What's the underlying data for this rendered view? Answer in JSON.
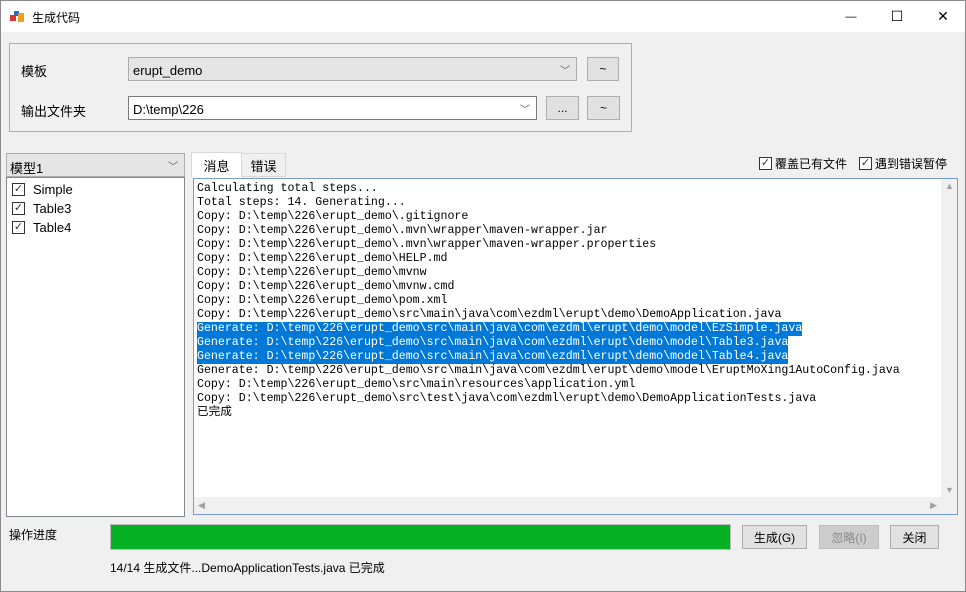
{
  "window": {
    "title": "生成代码",
    "minimize": "—",
    "maximize": "☐",
    "close": "✕"
  },
  "template": {
    "label": "模板",
    "value": "erupt_demo",
    "tilde": "~"
  },
  "output": {
    "label": "输出文件夹",
    "value": "D:\\temp\\226",
    "browse": "...",
    "tilde": "~"
  },
  "model": {
    "selected": "模型1",
    "items": [
      {
        "label": "Simple",
        "checked": true
      },
      {
        "label": "Table3",
        "checked": true
      },
      {
        "label": "Table4",
        "checked": true
      }
    ]
  },
  "tabs": [
    {
      "label": "消息",
      "active": true
    },
    {
      "label": "错误",
      "active": false
    }
  ],
  "options": {
    "overwrite": "覆盖已有文件",
    "pause_on_error": "遇到错误暂停"
  },
  "log": [
    {
      "text": "Calculating total steps...",
      "sel": false
    },
    {
      "text": "Total steps: 14. Generating...",
      "sel": false
    },
    {
      "text": "Copy: D:\\temp\\226\\erupt_demo\\.gitignore",
      "sel": false
    },
    {
      "text": "Copy: D:\\temp\\226\\erupt_demo\\.mvn\\wrapper\\maven-wrapper.jar",
      "sel": false
    },
    {
      "text": "Copy: D:\\temp\\226\\erupt_demo\\.mvn\\wrapper\\maven-wrapper.properties",
      "sel": false
    },
    {
      "text": "Copy: D:\\temp\\226\\erupt_demo\\HELP.md",
      "sel": false
    },
    {
      "text": "Copy: D:\\temp\\226\\erupt_demo\\mvnw",
      "sel": false
    },
    {
      "text": "Copy: D:\\temp\\226\\erupt_demo\\mvnw.cmd",
      "sel": false
    },
    {
      "text": "Copy: D:\\temp\\226\\erupt_demo\\pom.xml",
      "sel": false
    },
    {
      "text": "Copy: D:\\temp\\226\\erupt_demo\\src\\main\\java\\com\\ezdml\\erupt\\demo\\DemoApplication.java",
      "sel": false
    },
    {
      "text": "Generate: D:\\temp\\226\\erupt_demo\\src\\main\\java\\com\\ezdml\\erupt\\demo\\model\\EzSimple.java",
      "sel": true
    },
    {
      "text": "Generate: D:\\temp\\226\\erupt_demo\\src\\main\\java\\com\\ezdml\\erupt\\demo\\model\\Table3.java",
      "sel": true
    },
    {
      "text": "Generate: D:\\temp\\226\\erupt_demo\\src\\main\\java\\com\\ezdml\\erupt\\demo\\model\\Table4.java",
      "sel": true
    },
    {
      "text": "Generate: D:\\temp\\226\\erupt_demo\\src\\main\\java\\com\\ezdml\\erupt\\demo\\model\\EruptMoXing1AutoConfig.java",
      "sel": false
    },
    {
      "text": "Copy: D:\\temp\\226\\erupt_demo\\src\\main\\resources\\application.yml",
      "sel": false
    },
    {
      "text": "Copy: D:\\temp\\226\\erupt_demo\\src\\test\\java\\com\\ezdml\\erupt\\demo\\DemoApplicationTests.java",
      "sel": false
    },
    {
      "text": "已完成",
      "sel": false
    }
  ],
  "progress": {
    "label": "操作进度",
    "percent": 100,
    "status": "14/14 生成文件...DemoApplicationTests.java 已完成",
    "color": "#06b025"
  },
  "buttons": {
    "generate": "生成(G)",
    "ignore": "忽略(I)",
    "close": "关闭"
  }
}
